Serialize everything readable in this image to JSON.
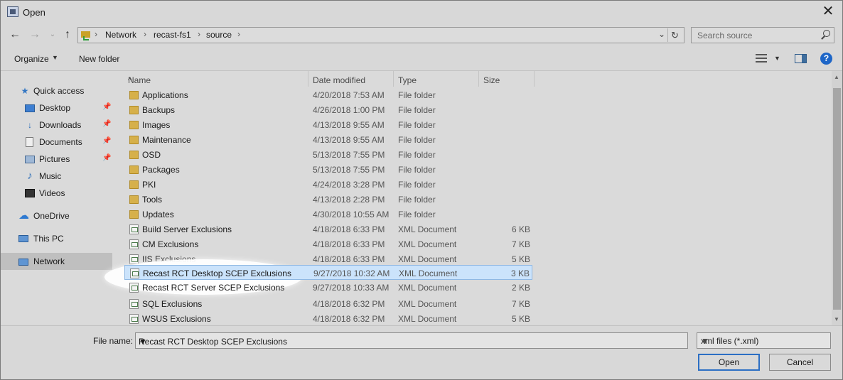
{
  "window": {
    "title": "Open"
  },
  "address": {
    "crumbs": [
      "Network",
      "recast-fs1",
      "source"
    ],
    "search_placeholder": "Search source"
  },
  "toolbar": {
    "organize": "Organize",
    "new_folder": "New folder"
  },
  "sidebar": {
    "items": [
      {
        "label": "Quick access",
        "icon": "star-icon"
      },
      {
        "label": "Desktop",
        "icon": "desktop-icon",
        "pinned": true
      },
      {
        "label": "Downloads",
        "icon": "download-icon",
        "pinned": true
      },
      {
        "label": "Documents",
        "icon": "documents-icon",
        "pinned": true
      },
      {
        "label": "Pictures",
        "icon": "pictures-icon",
        "pinned": true
      },
      {
        "label": "Music",
        "icon": "music-icon"
      },
      {
        "label": "Videos",
        "icon": "videos-icon"
      },
      {
        "label": "OneDrive",
        "icon": "cloud-icon"
      },
      {
        "label": "This PC",
        "icon": "computer-icon"
      },
      {
        "label": "Network",
        "icon": "network-icon",
        "selected": true
      }
    ]
  },
  "columns": {
    "name": "Name",
    "date": "Date modified",
    "type": "Type",
    "size": "Size"
  },
  "files": [
    {
      "name": "Applications",
      "date": "4/20/2018 7:53 AM",
      "type": "File folder",
      "size": ""
    },
    {
      "name": "Backups",
      "date": "4/26/2018 1:00 PM",
      "type": "File folder",
      "size": ""
    },
    {
      "name": "Images",
      "date": "4/13/2018 9:55 AM",
      "type": "File folder",
      "size": ""
    },
    {
      "name": "Maintenance",
      "date": "4/13/2018 9:55 AM",
      "type": "File folder",
      "size": ""
    },
    {
      "name": "OSD",
      "date": "5/13/2018 7:55 PM",
      "type": "File folder",
      "size": ""
    },
    {
      "name": "Packages",
      "date": "5/13/2018 7:55 PM",
      "type": "File folder",
      "size": ""
    },
    {
      "name": "PKI",
      "date": "4/24/2018 3:28 PM",
      "type": "File folder",
      "size": ""
    },
    {
      "name": "Tools",
      "date": "4/13/2018 2:28 PM",
      "type": "File folder",
      "size": ""
    },
    {
      "name": "Updates",
      "date": "4/30/2018 10:55 AM",
      "type": "File folder",
      "size": ""
    },
    {
      "name": "Build Server Exclusions",
      "date": "4/18/2018 6:33 PM",
      "type": "XML Document",
      "size": "6 KB"
    },
    {
      "name": "CM Exclusions",
      "date": "4/18/2018 6:33 PM",
      "type": "XML Document",
      "size": "7 KB"
    },
    {
      "name": "IIS Exclusions",
      "date": "4/18/2018 6:33 PM",
      "type": "XML Document",
      "size": "5 KB"
    },
    {
      "name": "Recast RCT Desktop SCEP Exclusions",
      "date": "9/27/2018 10:32 AM",
      "type": "XML Document",
      "size": "3 KB",
      "selected": true
    },
    {
      "name": "Recast RCT Server SCEP Exclusions",
      "date": "9/27/2018 10:33 AM",
      "type": "XML Document",
      "size": "2 KB"
    },
    {
      "name": "SQL Exclusions",
      "date": "4/18/2018 6:32 PM",
      "type": "XML Document",
      "size": "7 KB"
    },
    {
      "name": "WSUS Exclusions",
      "date": "4/18/2018 6:32 PM",
      "type": "XML Document",
      "size": "5 KB"
    }
  ],
  "footer": {
    "file_name_label": "File name:",
    "file_name_value": "Recast RCT Desktop SCEP Exclusions",
    "file_type": "xml files (*.xml)",
    "open": "Open",
    "cancel": "Cancel"
  }
}
